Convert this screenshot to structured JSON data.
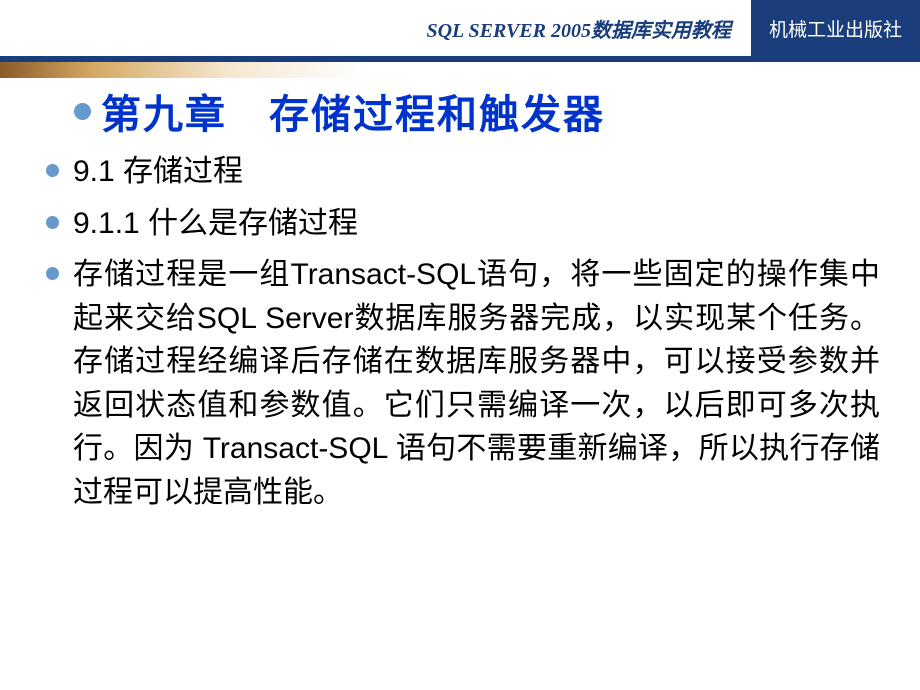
{
  "header": {
    "title": "SQL SERVER 2005数据库实用教程",
    "publisher": "机械工业出版社"
  },
  "chapter": {
    "title": "第九章　存储过程和触发器"
  },
  "sections": [
    {
      "text": "9.1 存储过程"
    },
    {
      "text": "9.1.1  什么是存储过程"
    },
    {
      "text": "存储过程是一组Transact-SQL语句，将一些固定的操作集中起来交给SQL Server数据库服务器完成，以实现某个任务。存储过程经编译后存储在数据库服务器中，可以接受参数并返回状态值和参数值。它们只需编译一次，以后即可多次执行。因为 Transact-SQL 语句不需要重新编译，所以执行存储过程可以提高性能。"
    }
  ]
}
